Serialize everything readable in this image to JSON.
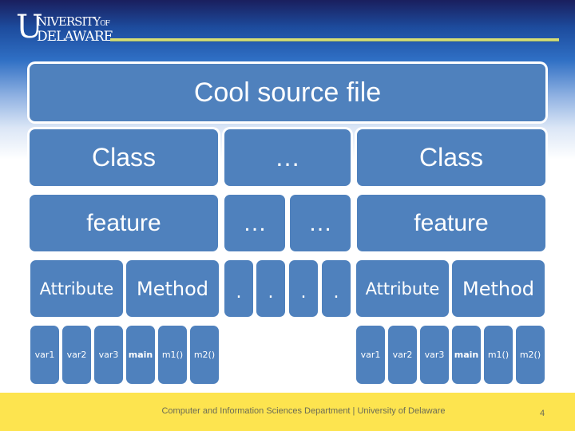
{
  "header": {
    "logo_initial": "U",
    "logo_line1": "NIVERSITY",
    "logo_line1_suffix": "OF",
    "logo_line2": "DELAWARE"
  },
  "diagram": {
    "root": "Cool source file",
    "level2": [
      "Class",
      "…",
      "Class"
    ],
    "level3": [
      "feature",
      "…",
      "…",
      "feature"
    ],
    "level4": [
      "Attribute",
      "Method",
      ".",
      ".",
      ".",
      ".",
      "Attribute",
      "Method"
    ],
    "leaves_left": [
      "var1",
      "var2",
      "var3",
      "main",
      "m1()",
      "m2()"
    ],
    "leaves_right": [
      "var1",
      "var2",
      "var3",
      "main",
      "m1()",
      "m2()"
    ]
  },
  "colors": {
    "box_fill": "#4f81bd",
    "box_text": "#ffffff",
    "footer_bg": "#fde44f",
    "accent_rule": "#d8df74"
  },
  "footer": {
    "text": "Computer and Information Sciences Department | University of Delaware",
    "page_number": "4"
  }
}
